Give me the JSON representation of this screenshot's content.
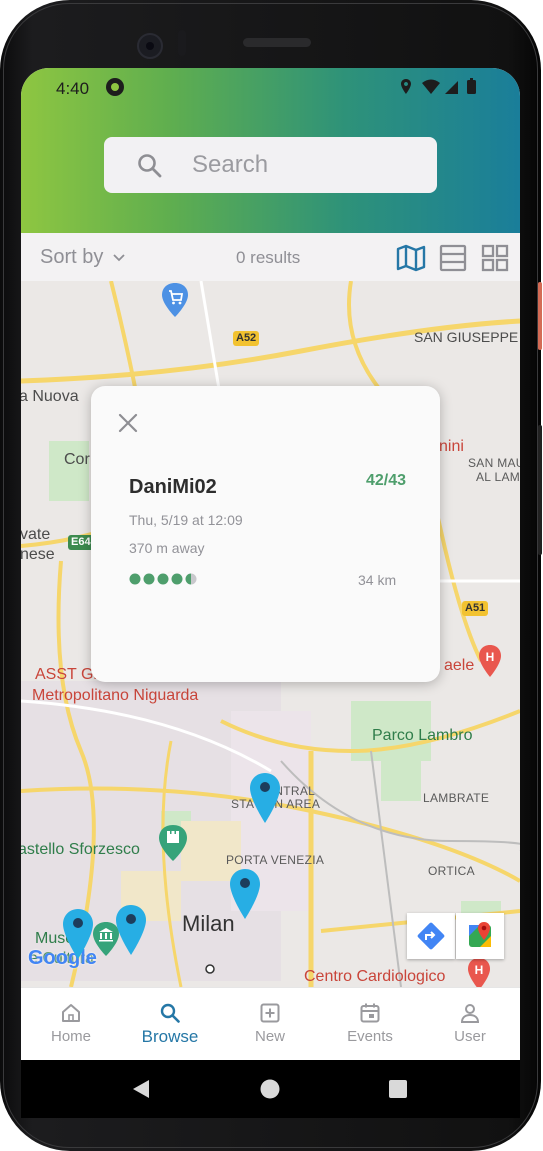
{
  "status_bar": {
    "time": "4:40"
  },
  "search": {
    "placeholder": "Search"
  },
  "toolbar": {
    "sort_label": "Sort by",
    "results_label": "0 results"
  },
  "map": {
    "labels": {
      "san_giuseppe": "SAN GIUSEPPE",
      "nuova": "a Nuova",
      "cor": "Cor",
      "vate": "vate",
      "nese": "nese",
      "nini": "nini",
      "san_mauro": "SAN MAURO",
      "al_lambro": "AL LAMBRO",
      "asst": "ASST Gr",
      "metropolitano": "Metropolitano Niguarda",
      "aele": "aele",
      "parco_lambro": "Parco Lambro",
      "lambrate": "LAMBRATE",
      "central": "CENTRAL",
      "station_area": "STATION AREA",
      "porta_venezia": "PORTA VENEZIA",
      "castello": "astello Sforzesco",
      "ortica": "ORTICA",
      "milan": "Milan",
      "museo": "Museo",
      "cultura": "e Cultura",
      "google": "Google",
      "centro": "Centro Cardiologico"
    },
    "shields": [
      "A52",
      "E64",
      "A51"
    ],
    "pin_count": 4
  },
  "popup": {
    "name": "DaniMi02",
    "score": "42/43",
    "date": "Thu, 5/19 at 12:09",
    "distance_away": "370 m away",
    "length": "34 km",
    "difficulty_rating": 4.5,
    "difficulty_max": 5
  },
  "bottom_nav": {
    "items": [
      {
        "label": "Home",
        "icon": "home-icon",
        "active": false
      },
      {
        "label": "Browse",
        "icon": "search-icon",
        "active": true
      },
      {
        "label": "New",
        "icon": "plus-square-icon",
        "active": false
      },
      {
        "label": "Events",
        "icon": "calendar-icon",
        "active": false
      },
      {
        "label": "User",
        "icon": "user-icon",
        "active": false
      }
    ]
  },
  "colors": {
    "accent": "#2577a6",
    "header_gradient_start": "#8ec641",
    "header_gradient_end": "#1a7e9a",
    "score_green": "#4e9e6c",
    "pin_blue": "#27aee4"
  }
}
